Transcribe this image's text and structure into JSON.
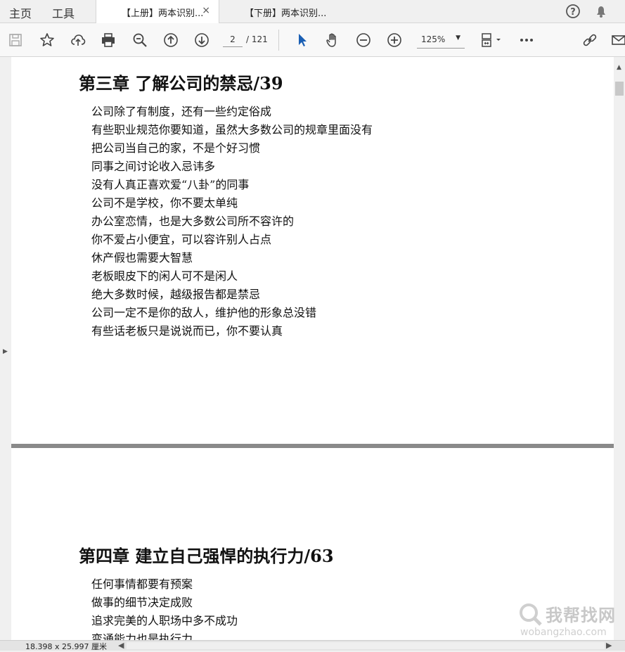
{
  "top_nav": {
    "home": "主页",
    "tools": "工具"
  },
  "tabs": [
    {
      "label": "【上册】两本识别...",
      "close": "×"
    },
    {
      "label": "【下册】两本识别..."
    }
  ],
  "toolbar": {
    "page_current": "2",
    "page_total": "/ 121",
    "zoom": "125%",
    "zoom_arrow": "▼"
  },
  "icons": {
    "help": "help-icon",
    "notifications": "bell-icon",
    "save": "save-icon",
    "bookmark": "star-icon",
    "upload": "cloud-upload-icon",
    "print": "print-icon",
    "zoom_search": "zoom-out-search-icon",
    "prev_page": "arrow-up-circle-icon",
    "next_page": "arrow-down-circle-icon",
    "select": "cursor-icon",
    "hand": "hand-icon",
    "zoom_out": "minus-circle-icon",
    "zoom_in": "plus-circle-icon",
    "page_display": "page-display-icon",
    "more": "more-icon",
    "share": "share-link-icon",
    "email": "email-icon"
  },
  "document": {
    "chapter3": {
      "title": "第三章  了解公司的禁忌/39",
      "items": [
        "公司除了有制度，还有一些约定俗成",
        "有些职业规范你要知道，虽然大多数公司的规章里面没有",
        "把公司当自己的家，不是个好习惯",
        "同事之间讨论收入忌讳多",
        "没有人真正喜欢爱“八卦”的同事",
        "公司不是学校，你不要太单纯",
        "办公室恋情，也是大多数公司所不容许的",
        "你不爱占小便宜，可以容许别人占点",
        "休产假也需要大智慧",
        "老板眼皮下的闲人可不是闲人",
        "绝大多数时候，越级报告都是禁忌",
        "公司一定不是你的敌人，维护他的形象总没错",
        "有些话老板只是说说而已，你不要认真"
      ]
    },
    "chapter4": {
      "title": "第四章  建立自己强悍的执行力/63",
      "items": [
        "任何事情都要有预案",
        "做事的细节决定成败",
        "追求完美的人职场中多不成功",
        "变通能力也是执行力"
      ]
    }
  },
  "status": {
    "dimensions": "18.398 x 25.997 厘米"
  },
  "watermark": {
    "text": "我帮找网",
    "url": "wobangzhao.com"
  },
  "colors": {
    "accent_blue": "#1a5fb4",
    "page_separator": "#8a8a8a"
  }
}
